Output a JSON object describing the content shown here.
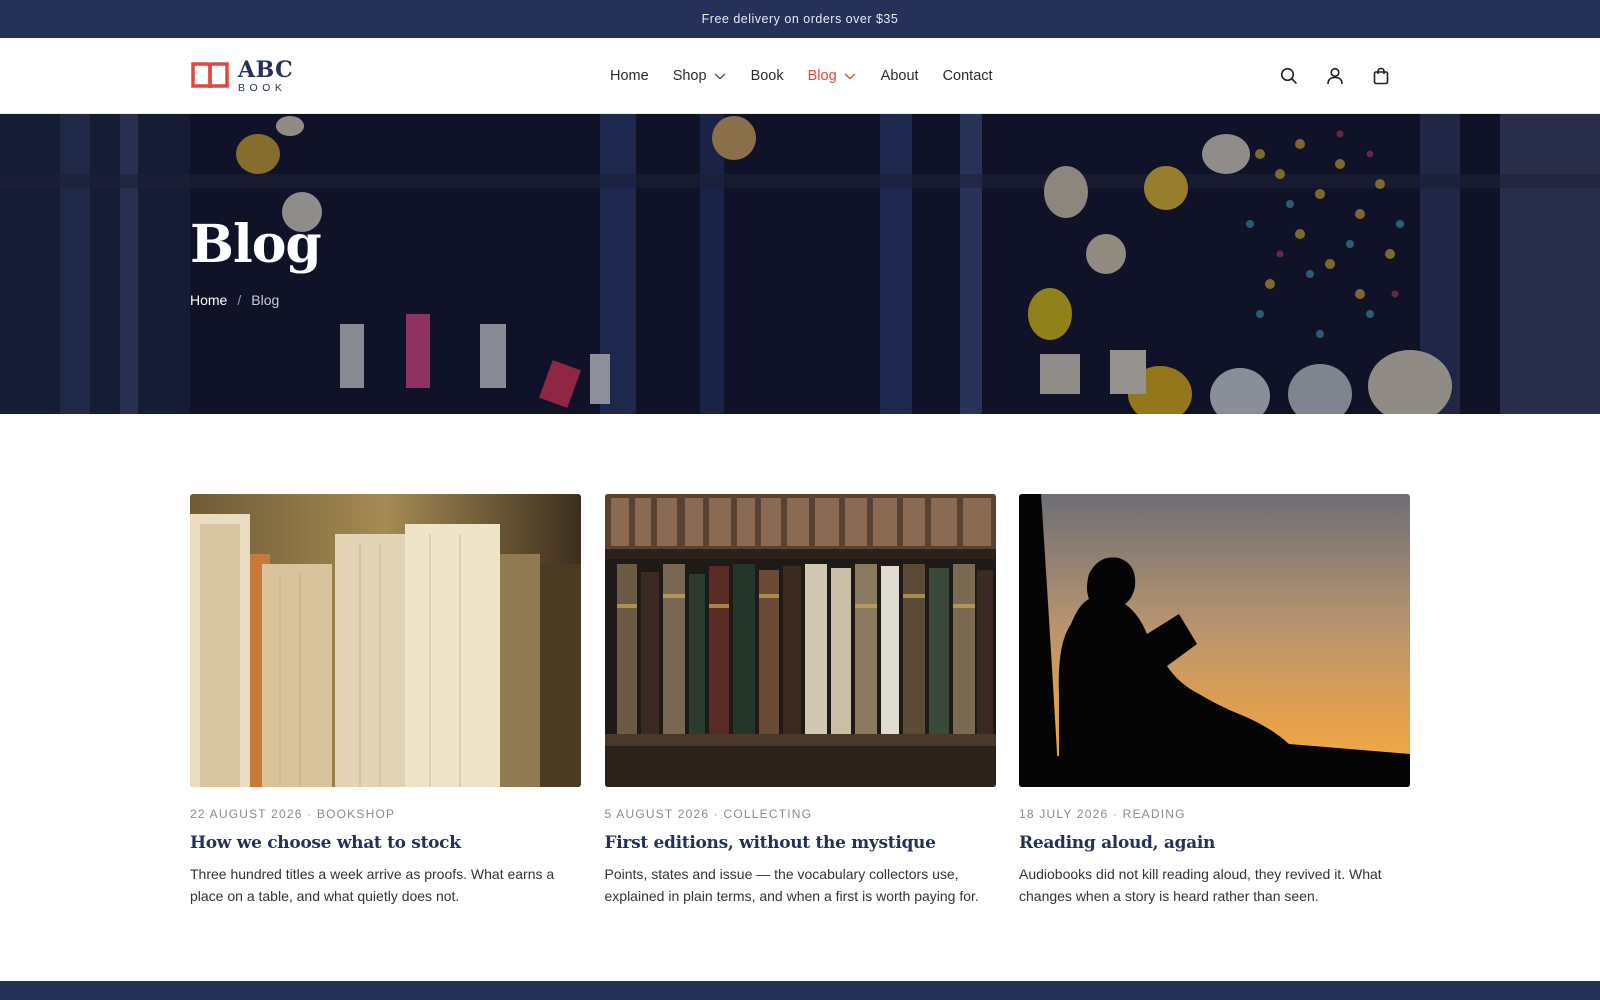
{
  "announcement": {
    "text": "Free delivery on orders over $35"
  },
  "brand": {
    "name": "ABC",
    "sub": "BOOK"
  },
  "nav": {
    "items": [
      {
        "label": "Home"
      },
      {
        "label": "Shop"
      },
      {
        "label": "Book"
      },
      {
        "label": "Blog"
      },
      {
        "label": "About"
      },
      {
        "label": "Contact"
      }
    ]
  },
  "icons": {
    "search": "search-icon",
    "account": "user-icon",
    "cart": "shopping-bag-icon"
  },
  "hero": {
    "title": "Blog"
  },
  "breadcrumb": {
    "home": "Home",
    "separator": "/",
    "current": "Blog"
  },
  "posts": [
    {
      "meta": "22 August 2026 · Bookshop",
      "title": "How we choose what to stock",
      "excerpt": "Three hundred titles a week arrive as proofs. What earns a place on a table, and what quietly does not."
    },
    {
      "meta": "5 August 2026 · Collecting",
      "title": "First editions, without the mystique",
      "excerpt": "Points, states and issue — the vocabulary collectors use, explained in plain terms, and when a first is worth paying for."
    },
    {
      "meta": "18 July 2026 · Reading",
      "title": "Reading aloud, again",
      "excerpt": "Audiobooks did not kill reading aloud, they revived it. What changes when a story is heard rather than seen."
    }
  ],
  "colors": {
    "navy": "#253159",
    "accent": "#e0473f"
  }
}
